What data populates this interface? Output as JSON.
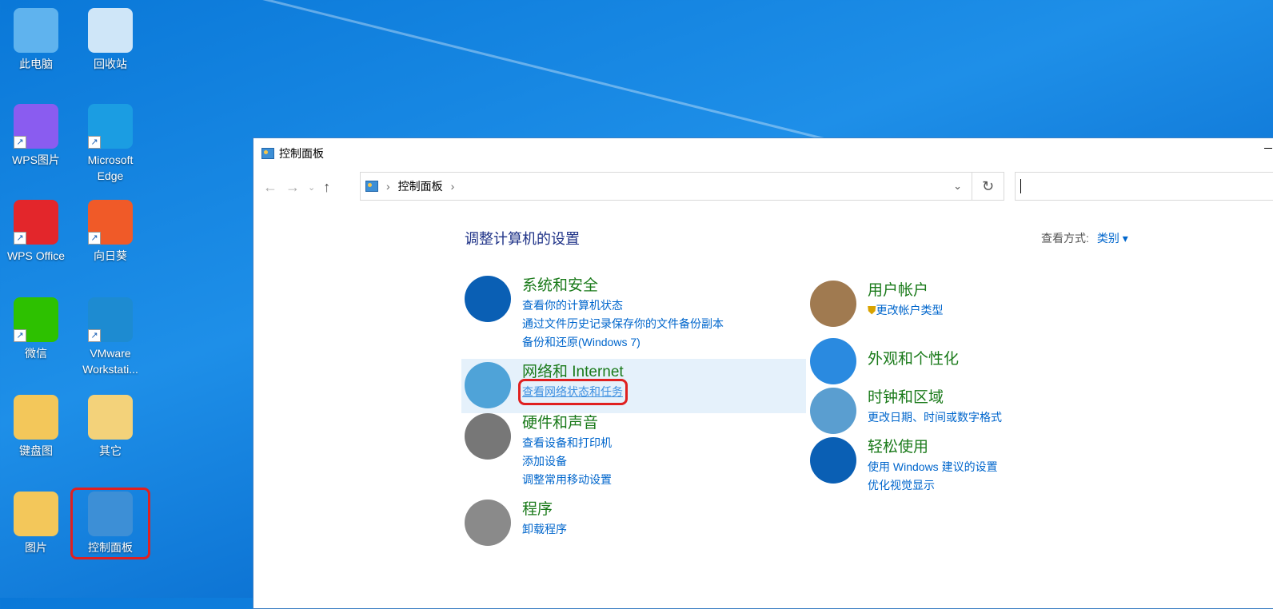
{
  "desktop": {
    "icons": [
      {
        "label": "此电脑",
        "color": "#5fb3ee"
      },
      {
        "label": "回收站",
        "color": "#cfe6f8"
      },
      {
        "label": "WPS图片",
        "color": "#8a5cf0"
      },
      {
        "label": "Microsoft Edge",
        "color": "#1b9de2"
      },
      {
        "label": "WPS Office",
        "color": "#e3262b"
      },
      {
        "label": "向日葵",
        "color": "#f05a28"
      },
      {
        "label": "微信",
        "color": "#2dc100"
      },
      {
        "label": "VMware Workstati...",
        "color": "#1d8bd1"
      },
      {
        "label": "键盘图",
        "color": "#f3c75a"
      },
      {
        "label": "其它",
        "color": "#f3d27a"
      },
      {
        "label": "图片",
        "color": "#f3c75a"
      },
      {
        "label": "控制面板",
        "color": "#3d8fd6"
      }
    ]
  },
  "window": {
    "title": "控制面板",
    "address": {
      "crumb": "控制面板",
      "sep": "›"
    },
    "search": {
      "value": ""
    },
    "heading": "调整计算机的设置",
    "viewby": {
      "label": "查看方式:",
      "value": "类别 ▾"
    },
    "categories": [
      {
        "title": "系统和安全",
        "links": [
          "查看你的计算机状态",
          "通过文件历史记录保存你的文件备份副本",
          "备份和还原(Windows 7)"
        ],
        "color": "#0a5fb4"
      },
      {
        "title": "网络和 Internet",
        "links": [
          "查看网络状态和任务"
        ],
        "color": "#4fa3d8"
      },
      {
        "title": "硬件和声音",
        "links": [
          "查看设备和打印机",
          "添加设备",
          "调整常用移动设置"
        ],
        "color": "#777777"
      },
      {
        "title": "程序",
        "links": [
          "卸载程序"
        ],
        "color": "#8a8a8a"
      },
      {
        "title": "用户帐户",
        "links": [
          "更改帐户类型"
        ],
        "color": "#a07a50"
      },
      {
        "title": "外观和个性化",
        "links": [],
        "color": "#2a8ae0"
      },
      {
        "title": "时钟和区域",
        "links": [
          "更改日期、时间或数字格式"
        ],
        "color": "#5a9ed0"
      },
      {
        "title": "轻松使用",
        "links": [
          "使用 Windows 建议的设置",
          "优化视觉显示"
        ],
        "color": "#0a5fb4"
      }
    ]
  }
}
